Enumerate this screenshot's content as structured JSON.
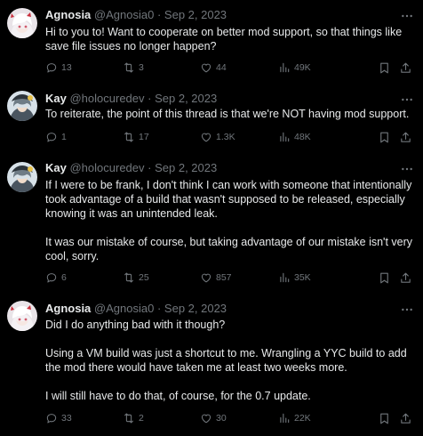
{
  "tweets": [
    {
      "name": "Agnosia",
      "handle": "@Agnosia0",
      "dot": "·",
      "date": "Sep 2, 2023",
      "paragraphs": [
        "Hi to you to! Want to cooperate on better mod support, so that things like save file issues no longer happen?"
      ],
      "replies": "13",
      "reposts": "3",
      "likes": "44",
      "views": "49K"
    },
    {
      "name": "Kay",
      "handle": "@holocuredev",
      "dot": "·",
      "date": "Sep 2, 2023",
      "paragraphs": [
        "To reiterate, the point of this thread is that we're NOT having mod support."
      ],
      "replies": "1",
      "reposts": "17",
      "likes": "1.3K",
      "views": "48K"
    },
    {
      "name": "Kay",
      "handle": "@holocuredev",
      "dot": "·",
      "date": "Sep 2, 2023",
      "paragraphs": [
        "If I were to be frank, I don't think I can work with someone that intentionally took advantage of a build that wasn't supposed to be released, especially knowing it was an unintended leak.",
        "It was our mistake of course, but taking advantage of our mistake isn't very cool, sorry."
      ],
      "replies": "6",
      "reposts": "25",
      "likes": "857",
      "views": "35K"
    },
    {
      "name": "Agnosia",
      "handle": "@Agnosia0",
      "dot": "·",
      "date": "Sep 2, 2023",
      "paragraphs": [
        "Did I do anything bad with it though?",
        "Using a VM build was just a shortcut to me. Wrangling a YYC build to add the mod there would have taken me at least two weeks more.",
        "I will still have to do that, of course, for the 0.7 update."
      ],
      "replies": "33",
      "reposts": "2",
      "likes": "30",
      "views": "22K"
    }
  ],
  "icons": {
    "reply": "reply-icon",
    "repost": "repost-icon",
    "like": "heart-icon",
    "views": "views-icon",
    "bookmark": "bookmark-icon",
    "share": "share-icon",
    "more": "more-icon"
  },
  "colors": {
    "background": "#000000",
    "text": "#e7e9ea",
    "secondary": "#71767b",
    "thread_line": "#333639"
  }
}
